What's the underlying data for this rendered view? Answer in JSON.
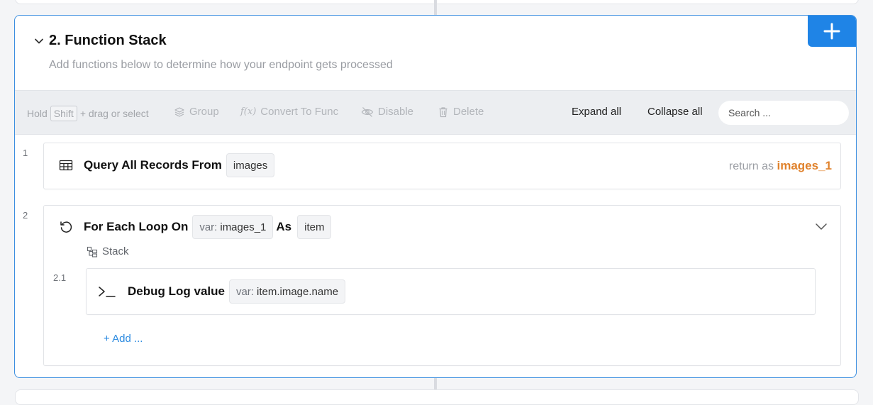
{
  "section": {
    "title": "2. Function Stack",
    "subtitle": "Add functions below to determine how your endpoint gets processed",
    "add_button_icon": "plus-icon",
    "collapse_icon": "chevron-down-icon"
  },
  "toolbar": {
    "hold_text": "Hold",
    "shift_key": "Shift",
    "drag_text": "+ drag or select",
    "group_label": "Group",
    "convert_label": "Convert To Func",
    "disable_label": "Disable",
    "delete_label": "Delete",
    "expand_all_label": "Expand all",
    "collapse_all_label": "Collapse all",
    "search_placeholder": "Search ..."
  },
  "steps": [
    {
      "number": "1",
      "icon": "table-icon",
      "name": "Query All Records From",
      "table": "images",
      "return_label": "return as",
      "return_var": "images_1"
    },
    {
      "number": "2",
      "icon": "loop-icon",
      "name": "For Each Loop On",
      "var_prefix": "var:",
      "var_name": "images_1",
      "as_label": "As",
      "item_name": "item",
      "stack_label": "Stack",
      "children": [
        {
          "number": "2.1",
          "icon": "terminal-icon",
          "name": "Debug Log value",
          "var_prefix": "var:",
          "var_name": "item.image.name"
        }
      ],
      "add_label": "+ Add ..."
    }
  ],
  "colors": {
    "accent": "#1f84e6",
    "return_var": "#e0822c",
    "panel_border": "#3c8fe0"
  }
}
